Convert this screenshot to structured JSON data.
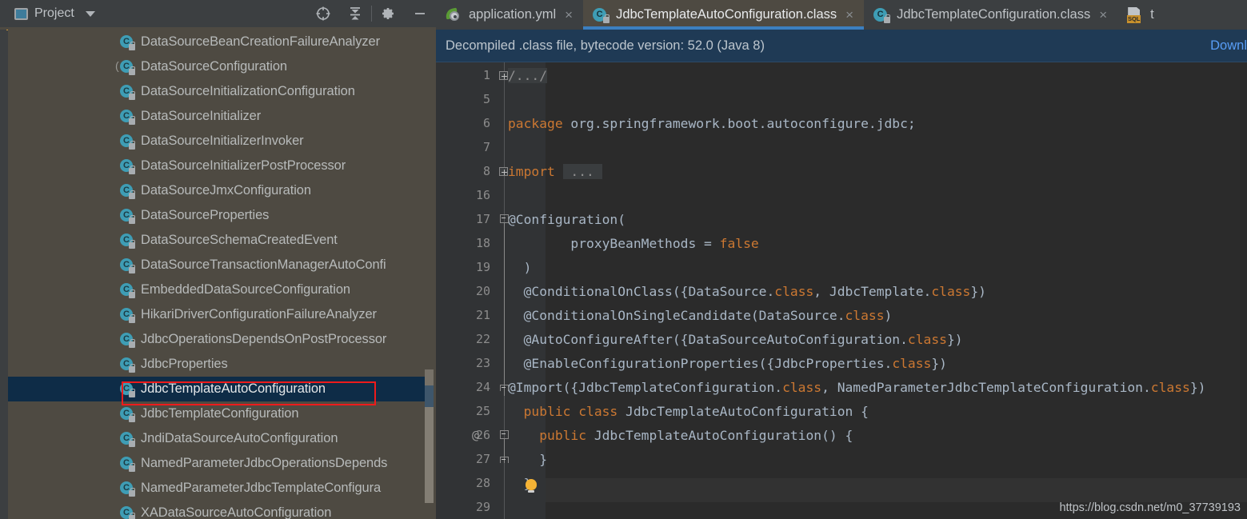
{
  "sidebar": {
    "header": {
      "title": "Project",
      "icons": [
        {
          "name": "locate-icon",
          "glyph": "locate"
        },
        {
          "name": "collapse-all-icon",
          "glyph": "collapse"
        },
        {
          "name": "settings-gear-icon",
          "glyph": "gear"
        },
        {
          "name": "hide-panel-icon",
          "glyph": "minus"
        }
      ]
    },
    "items": [
      {
        "label": "DataSourceBeanCreationFailureAnalyzer",
        "selected": false,
        "paren": false
      },
      {
        "label": "DataSourceConfiguration",
        "selected": false,
        "paren": true
      },
      {
        "label": "DataSourceInitializationConfiguration",
        "selected": false,
        "paren": false
      },
      {
        "label": "DataSourceInitializer",
        "selected": false,
        "paren": false
      },
      {
        "label": "DataSourceInitializerInvoker",
        "selected": false,
        "paren": false
      },
      {
        "label": "DataSourceInitializerPostProcessor",
        "selected": false,
        "paren": false
      },
      {
        "label": "DataSourceJmxConfiguration",
        "selected": false,
        "paren": false
      },
      {
        "label": "DataSourceProperties",
        "selected": false,
        "paren": false
      },
      {
        "label": "DataSourceSchemaCreatedEvent",
        "selected": false,
        "paren": false
      },
      {
        "label": "DataSourceTransactionManagerAutoConfi",
        "selected": false,
        "paren": false
      },
      {
        "label": "EmbeddedDataSourceConfiguration",
        "selected": false,
        "paren": false
      },
      {
        "label": "HikariDriverConfigurationFailureAnalyzer",
        "selected": false,
        "paren": false
      },
      {
        "label": "JdbcOperationsDependsOnPostProcessor",
        "selected": false,
        "paren": false
      },
      {
        "label": "JdbcProperties",
        "selected": false,
        "paren": false
      },
      {
        "label": "JdbcTemplateAutoConfiguration",
        "selected": true,
        "paren": false
      },
      {
        "label": "JdbcTemplateConfiguration",
        "selected": false,
        "paren": false
      },
      {
        "label": "JndiDataSourceAutoConfiguration",
        "selected": false,
        "paren": false
      },
      {
        "label": "NamedParameterJdbcOperationsDepends",
        "selected": false,
        "paren": false
      },
      {
        "label": "NamedParameterJdbcTemplateConfigura",
        "selected": false,
        "paren": false
      },
      {
        "label": "XADataSourceAutoConfiguration",
        "selected": false,
        "paren": false
      }
    ],
    "class_icon_letter": "C",
    "annotation_highlight_color": "#EE1B1B",
    "selection_color": "#0E2C47",
    "background_color": "#4E4A42"
  },
  "tabs": [
    {
      "label": "application.yml",
      "icon": "spring-yaml-icon",
      "active": false,
      "closable": true
    },
    {
      "label": "JdbcTemplateAutoConfiguration.class",
      "icon": "java-class-icon",
      "active": true,
      "closable": true
    },
    {
      "label": "JdbcTemplateConfiguration.class",
      "icon": "java-class-icon",
      "active": false,
      "closable": true
    },
    {
      "label": "t",
      "icon": "sql-file-icon",
      "active": false,
      "closable": false
    }
  ],
  "notice": {
    "text": "Decompiled .class file, bytecode version: 52.0 (Java 8)",
    "link": "Downl",
    "background_color": "#1F3A55",
    "link_color": "#589DF6"
  },
  "editor": {
    "lines": [
      {
        "num": "1",
        "marker": "fold-plus",
        "segments": [
          {
            "t": "/.../",
            "c": "fold"
          }
        ]
      },
      {
        "num": "5",
        "marker": "",
        "segments": []
      },
      {
        "num": "6",
        "marker": "",
        "segments": [
          {
            "t": "package ",
            "c": "kw"
          },
          {
            "t": "org.springframework.boot.autoconfigure.jdbc;",
            "c": "plain"
          }
        ]
      },
      {
        "num": "7",
        "marker": "",
        "segments": []
      },
      {
        "num": "8",
        "marker": "fold-plus",
        "segments": [
          {
            "t": "import ",
            "c": "kw"
          },
          {
            "t": " ... ",
            "c": "fold"
          }
        ]
      },
      {
        "num": "16",
        "marker": "",
        "segments": []
      },
      {
        "num": "17",
        "marker": "region-start",
        "segments": [
          {
            "t": "@Configuration(",
            "c": "plain"
          }
        ]
      },
      {
        "num": "18",
        "marker": "",
        "segments": [
          {
            "t": "        proxyBeanMethods = ",
            "c": "plain"
          },
          {
            "t": "false",
            "c": "kw"
          }
        ]
      },
      {
        "num": "19",
        "marker": "",
        "segments": [
          {
            "t": "  )",
            "c": "plain"
          }
        ]
      },
      {
        "num": "20",
        "marker": "",
        "segments": [
          {
            "t": "  @ConditionalOnClass({DataSource.",
            "c": "plain"
          },
          {
            "t": "class",
            "c": "kw"
          },
          {
            "t": ", JdbcTemplate.",
            "c": "plain"
          },
          {
            "t": "class",
            "c": "kw"
          },
          {
            "t": "})",
            "c": "plain"
          }
        ]
      },
      {
        "num": "21",
        "marker": "",
        "segments": [
          {
            "t": "  @ConditionalOnSingleCandidate(DataSource.",
            "c": "plain"
          },
          {
            "t": "class",
            "c": "kw"
          },
          {
            "t": ")",
            "c": "plain"
          }
        ]
      },
      {
        "num": "22",
        "marker": "",
        "segments": [
          {
            "t": "  @AutoConfigureAfter({DataSourceAutoConfiguration.",
            "c": "plain"
          },
          {
            "t": "class",
            "c": "kw"
          },
          {
            "t": "})",
            "c": "plain"
          }
        ]
      },
      {
        "num": "23",
        "marker": "",
        "segments": [
          {
            "t": "  @EnableConfigurationProperties({JdbcProperties.",
            "c": "plain"
          },
          {
            "t": "class",
            "c": "kw"
          },
          {
            "t": "})",
            "c": "plain"
          }
        ]
      },
      {
        "num": "24",
        "marker": "region-end",
        "segments": [
          {
            "t": "@Import({JdbcTemplateConfiguration.",
            "c": "plain"
          },
          {
            "t": "class",
            "c": "kw"
          },
          {
            "t": ", NamedParameterJdbcTemplateConfiguration.",
            "c": "plain"
          },
          {
            "t": "class",
            "c": "kw"
          },
          {
            "t": "})",
            "c": "plain"
          }
        ]
      },
      {
        "num": "25",
        "marker": "",
        "segments": [
          {
            "t": "  public class ",
            "c": "kw"
          },
          {
            "t": "JdbcTemplateAutoConfiguration {",
            "c": "plain"
          }
        ]
      },
      {
        "num": "26",
        "marker": "at-region",
        "segments": [
          {
            "t": "    public ",
            "c": "kw"
          },
          {
            "t": "JdbcTemplateAutoConfiguration() {",
            "c": "plain"
          }
        ]
      },
      {
        "num": "27",
        "marker": "region-close",
        "segments": [
          {
            "t": "    }",
            "c": "plain"
          }
        ]
      },
      {
        "num": "28",
        "marker": "bulb",
        "segments": [
          {
            "t": "  }",
            "c": "plain"
          }
        ]
      },
      {
        "num": "29",
        "marker": "",
        "segments": []
      }
    ],
    "gutter_at_symbol": "@",
    "background_color": "#2B2B2B",
    "gutter_color": "#313335",
    "keyword_color": "#CC7832",
    "text_color": "#A9B7C6"
  },
  "watermark": "https://blog.csdn.net/m0_37739193"
}
